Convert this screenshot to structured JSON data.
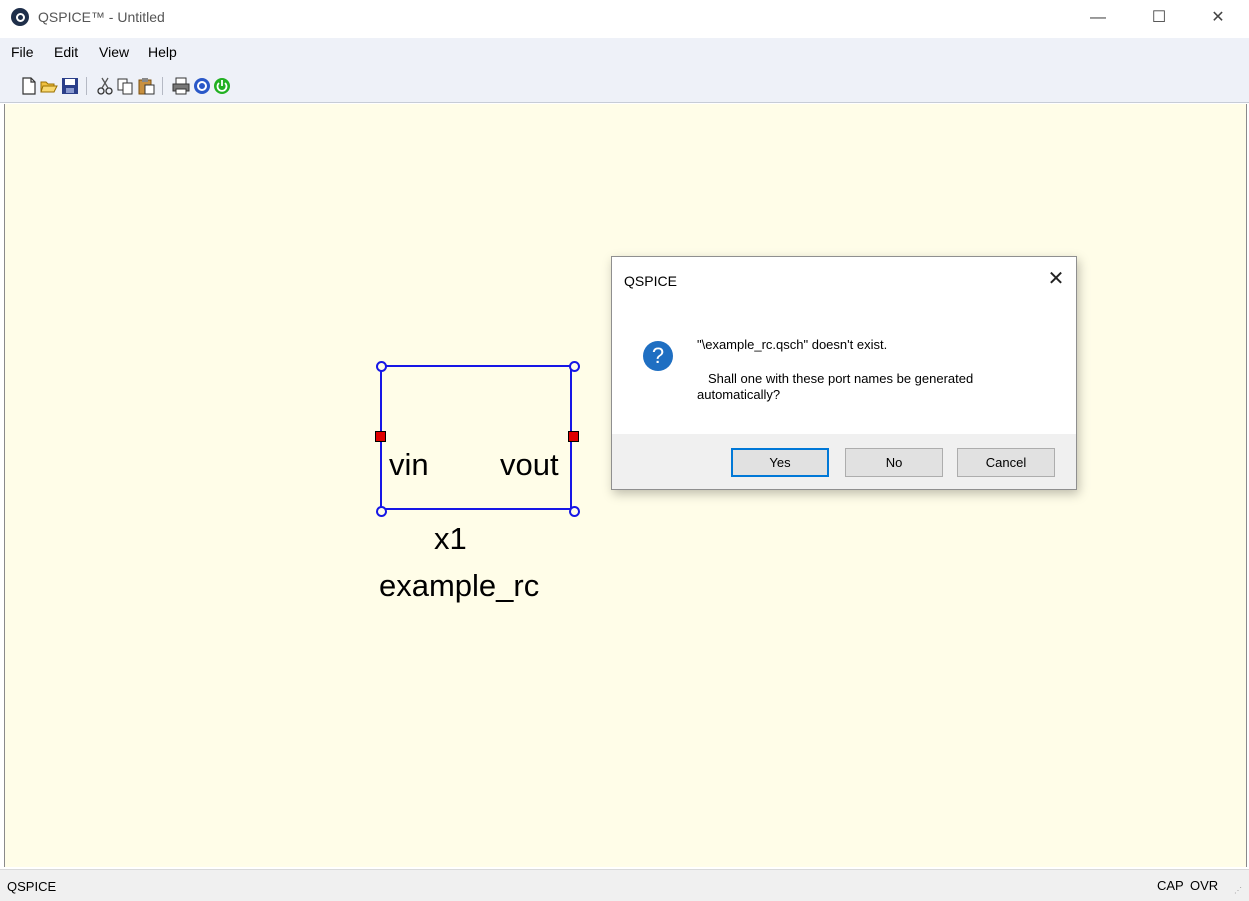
{
  "window": {
    "title": "QSPICE™ - Untitled",
    "controls": {
      "minimize": "—",
      "maximize": "☐",
      "close": "✕"
    }
  },
  "menu": {
    "items": [
      "File",
      "Edit",
      "View",
      "Help"
    ]
  },
  "toolbar": {
    "buttons": [
      "new-icon",
      "open-icon",
      "save-icon",
      "cut-icon",
      "copy-icon",
      "paste-icon",
      "print-icon",
      "help-icon",
      "power-icon"
    ]
  },
  "schematic": {
    "ports": {
      "left": "vin",
      "right": "vout"
    },
    "instance": "x1",
    "symbol": "example_rc",
    "colors": {
      "outline": "#1616e6",
      "pin": "#e00000",
      "canvas": "#fffde8"
    }
  },
  "dialog": {
    "title": "QSPICE",
    "close": "✕",
    "icon": "question-icon",
    "message_line1": "\"\\example_rc.qsch\" doesn't exist.",
    "message_line2": "Shall one with these port names be generated",
    "message_line3": "automatically?",
    "buttons": {
      "yes": "Yes",
      "no": "No",
      "cancel": "Cancel"
    }
  },
  "status": {
    "left": "QSPICE",
    "cap": "CAP",
    "ovr": "OVR"
  }
}
